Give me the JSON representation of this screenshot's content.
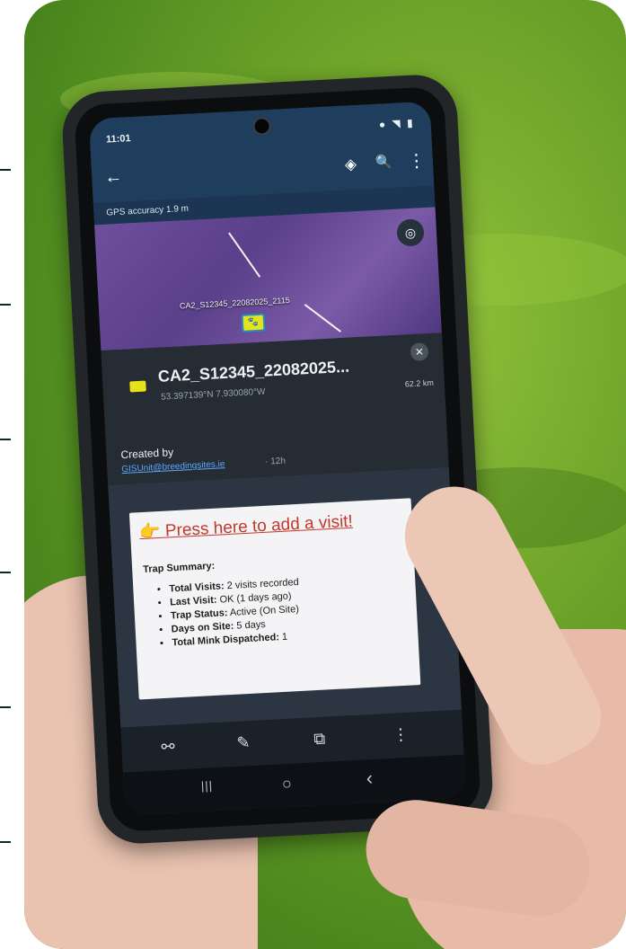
{
  "ruler_ticks": 6,
  "phone": {
    "status_bar": {
      "time": "11:01",
      "system_icons": "● ◥ ▮"
    },
    "app_bar": {
      "back_icon": "←",
      "layers_icon": "◈",
      "search_icon": "🔍",
      "more_icon": "⋮"
    },
    "gps_accuracy": "GPS accuracy 1.9 m",
    "map": {
      "feature_label": "CA2_S12345_22082025_2115",
      "locate_icon": "◎",
      "marker_icon": "🐾"
    },
    "feature_sheet": {
      "title": "CA2_S12345_22082025...",
      "coords": "53.397139°N 7.930080°W",
      "distance": "62.2 km",
      "close_icon": "✕",
      "created_label": "Created by",
      "created_by": "GISUnit@breedingsites.ie",
      "created_ago": "· 12h"
    },
    "visit_card": {
      "cta_icon": "👉",
      "cta": "Press here to add a visit!",
      "summary_title": "Trap Summary:",
      "items": [
        {
          "label": "Total Visits:",
          "value": "2 visits recorded"
        },
        {
          "label": "Last Visit:",
          "value": "OK (1 days ago)"
        },
        {
          "label": "Trap Status:",
          "value": "Active (On Site)"
        },
        {
          "label": "Days on Site:",
          "value": "5 days"
        },
        {
          "label": "Total Mink Dispatched:",
          "value": "1"
        }
      ]
    },
    "bottom_actions": {
      "link_icon": "⚯",
      "edit_icon": "✎",
      "copy_icon": "⧉",
      "more_icon": "⋮"
    },
    "nav_bar": {
      "recents_icon": "|||",
      "home_icon": "○",
      "back_icon": "‹"
    }
  }
}
